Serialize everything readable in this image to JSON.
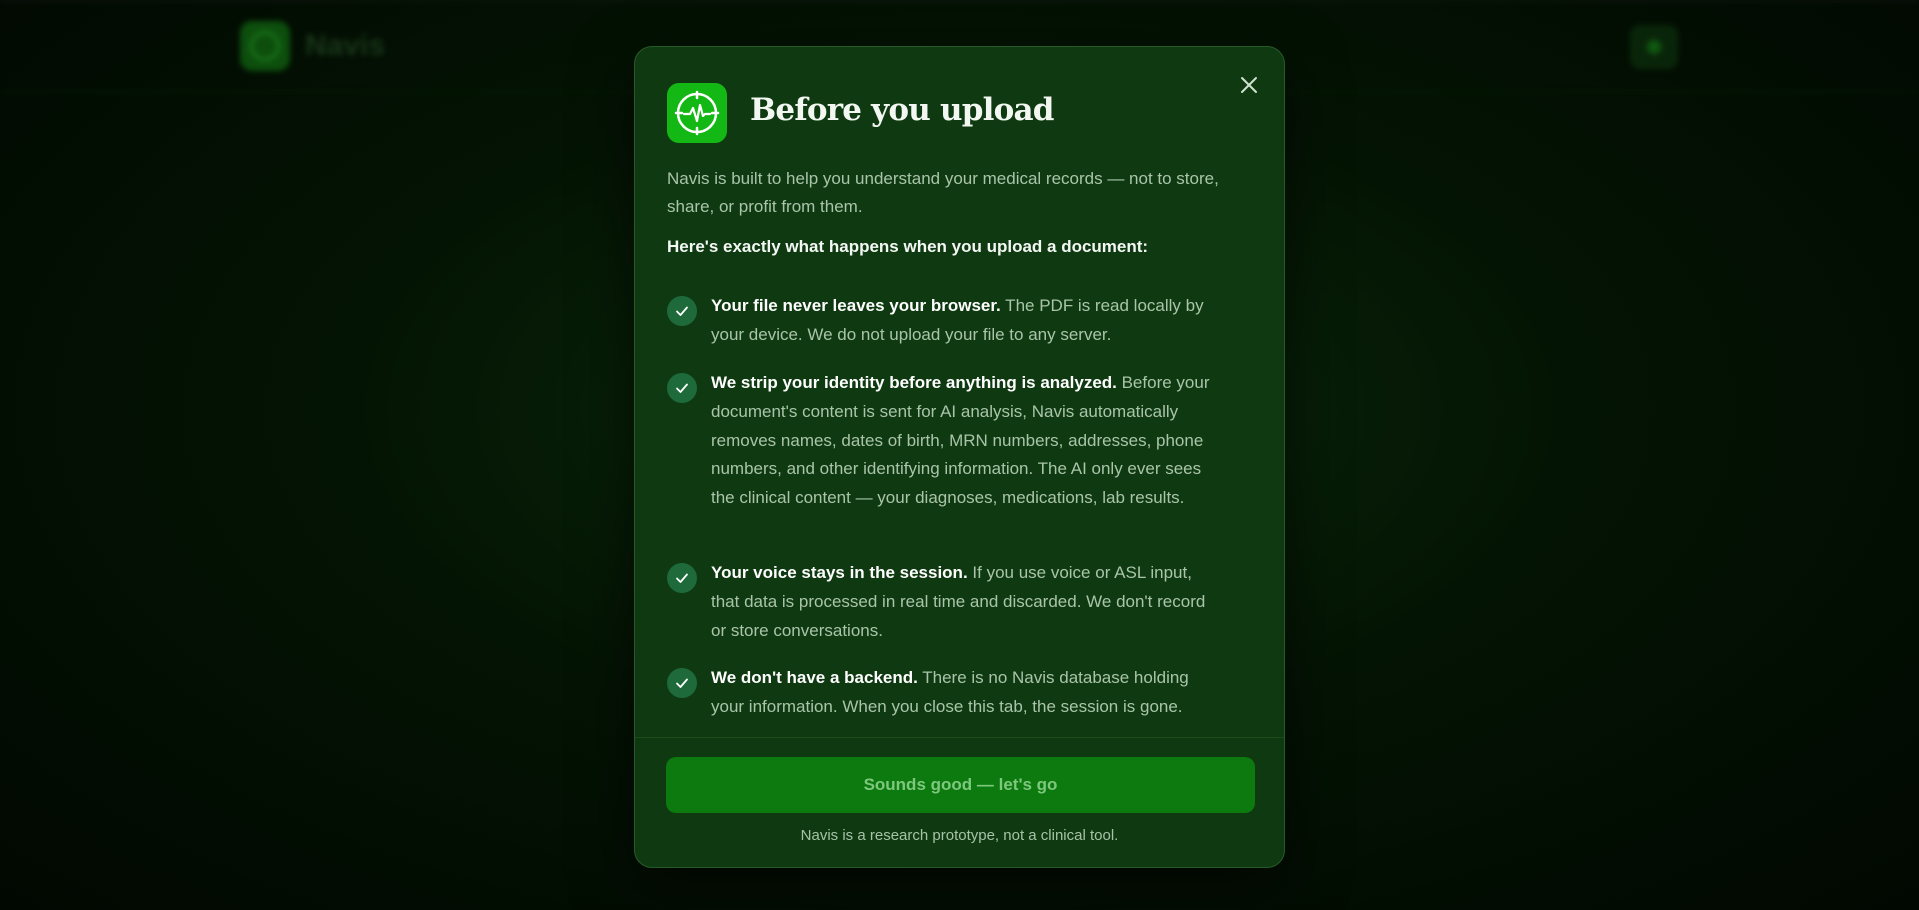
{
  "app": {
    "brand_name": "Navis"
  },
  "modal": {
    "title": "Before you upload",
    "intro": "Navis is built to help you understand your medical records — not to store, share, or profit from them.",
    "lead": "Here's exactly what happens when you upload a document:",
    "items": [
      {
        "heading": "Your file never leaves your browser.",
        "body": " The PDF is read locally by your device. We do not upload your file to any server."
      },
      {
        "heading": "We strip your identity before anything is analyzed.",
        "body": " Before your document's content is sent for AI analysis, Navis automatically removes names, dates of birth, MRN numbers, addresses, phone numbers, and other identifying information. The AI only ever sees the clinical content — your diagnoses, medications, lab results."
      },
      {
        "heading": "Your voice stays in the session.",
        "body": " If you use voice or ASL input, that data is processed in real time and discarded. We don't record or store conversations."
      },
      {
        "heading": "We don't have a backend.",
        "body": " There is no Navis database holding your information. When you close this tab, the session is gone."
      }
    ],
    "cta_label": "Sounds good — let's go",
    "footnote": "Navis is a research prototype, not a clinical tool."
  },
  "icons": {
    "logo": "heartbeat-monitor-icon",
    "close": "close-icon",
    "check": "checkmark-icon"
  },
  "colors": {
    "modal_background": "#0f3a11",
    "logo_green": "#14b814",
    "cta_background": "#0c7a0e",
    "check_badge": "#1e6a3a"
  }
}
